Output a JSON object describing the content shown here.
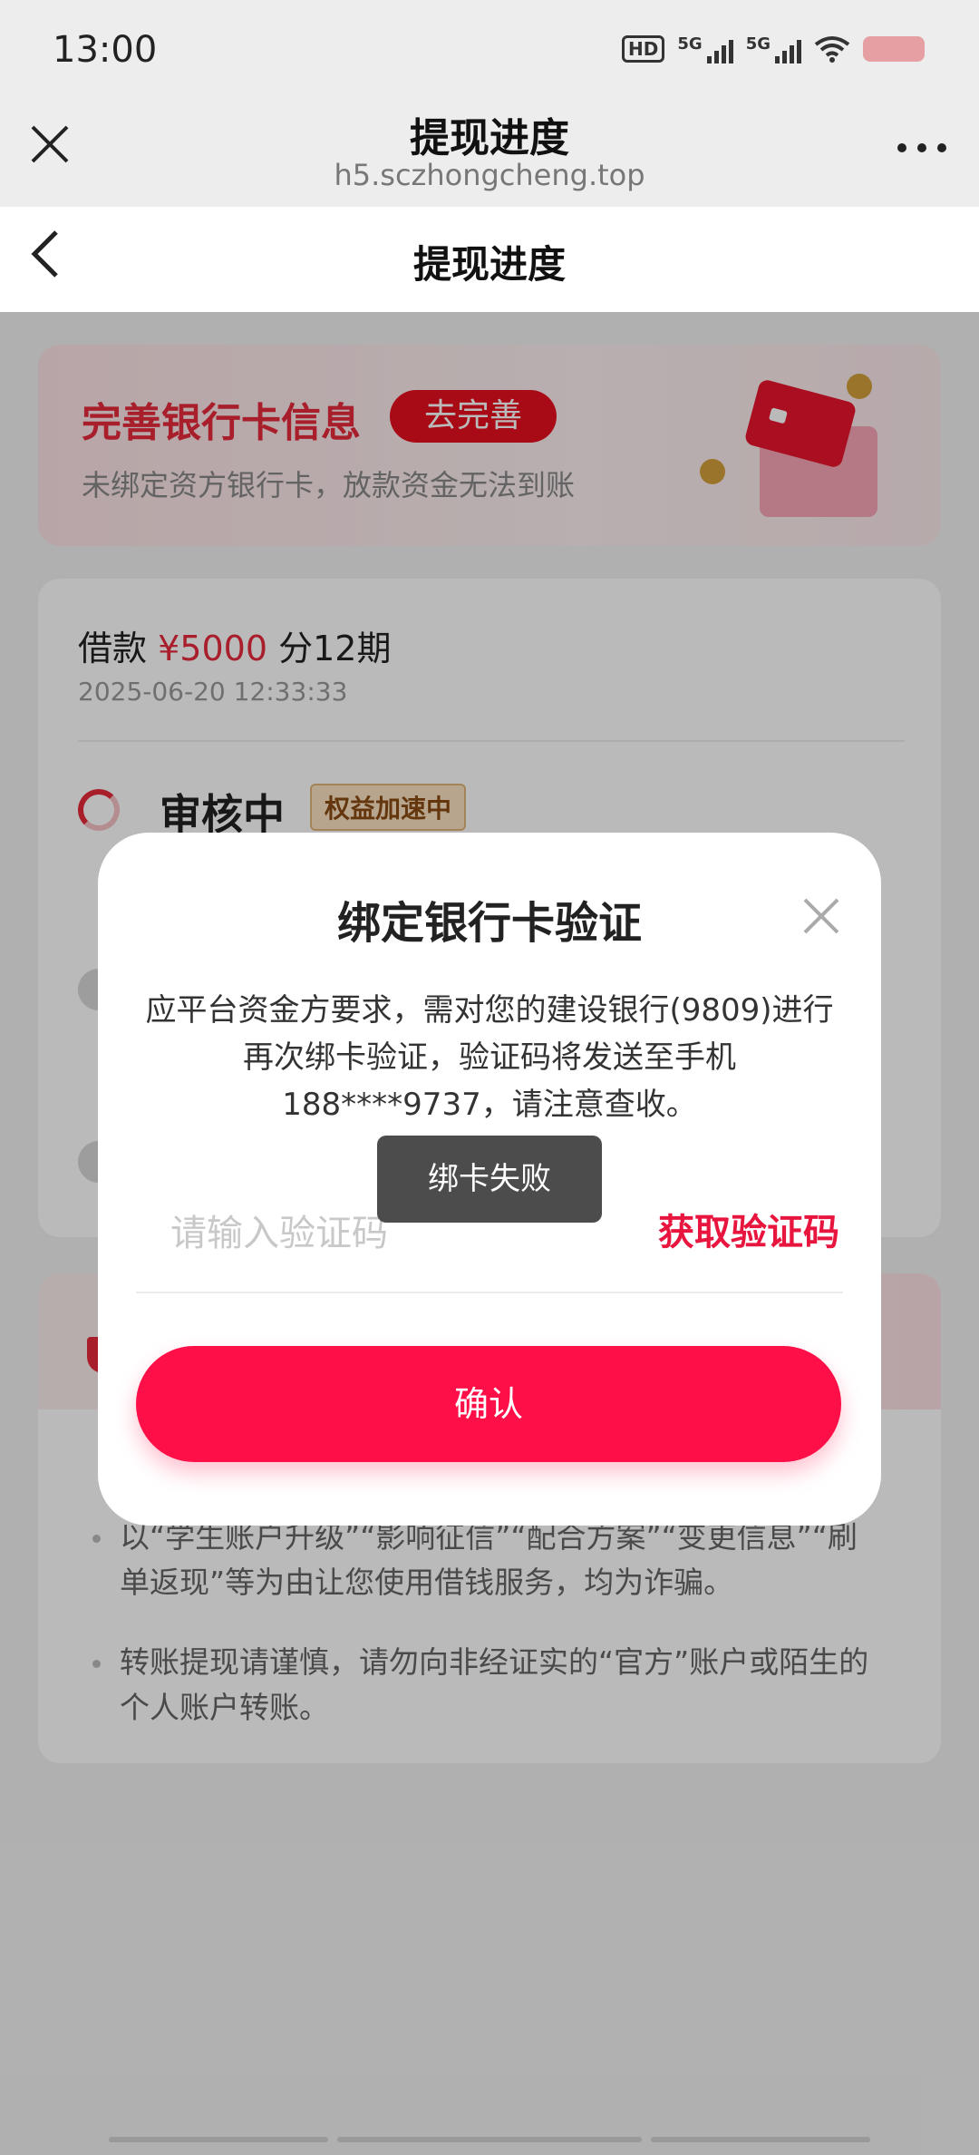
{
  "status_bar": {
    "time": "13:00",
    "hd_label": "HD",
    "signal1_label": "5G",
    "signal2_label": "5G"
  },
  "browser": {
    "title": "提现进度",
    "url": "h5.sczhongcheng.top"
  },
  "page": {
    "title": "提现进度"
  },
  "banner": {
    "title": "完善银行卡信息",
    "button": "去完善",
    "subtitle": "未绑定资方银行卡，放款资金无法到账"
  },
  "loan_card": {
    "prefix": "借款",
    "amount": "¥5000",
    "suffix": "分12期",
    "date": "2025-06-20 12:33:33",
    "status": "审核中",
    "badge": "权益加速中"
  },
  "tips": {
    "items": [
      "以“学生账户升级”“影响征信”“配合方案”“变更信息”“刷单返现”等为由让您使用借钱服务，均为诈骗。",
      "转账提现请谨慎，请勿向非经证实的“官方”账户或陌生的个人账户转账。"
    ]
  },
  "modal": {
    "title": "绑定银行卡验证",
    "description": "应平台资金方要求，需对您的建设银行(9809)进行再次绑卡验证，验证码将发送至手机188****9737，请注意查收。",
    "input_placeholder": "请输入验证码",
    "get_code": "获取验证码",
    "confirm": "确认"
  },
  "toast": {
    "text": "绑卡失败"
  },
  "colors": {
    "accent": "#e62b3c",
    "confirm": "#ff0f48"
  }
}
